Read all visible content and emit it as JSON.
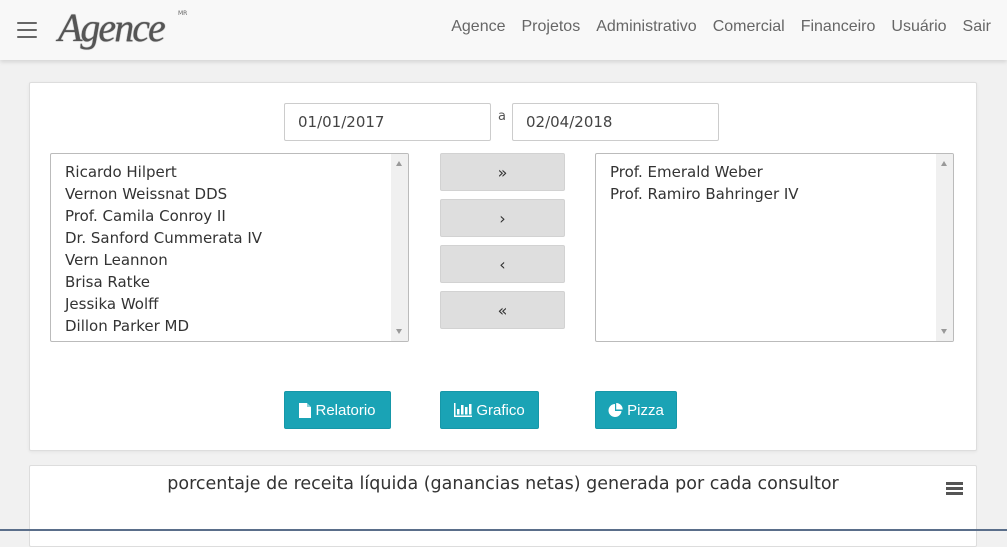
{
  "navbar": {
    "logo": "Agence",
    "logo_mark": "MR",
    "links": [
      "Agence",
      "Projetos",
      "Administrativo",
      "Comercial",
      "Financeiro",
      "Usuário",
      "Sair"
    ]
  },
  "filters": {
    "date_from": "01/01/2017",
    "separator": "a",
    "date_to": "02/04/2018"
  },
  "available_consultants": [
    "Ricardo Hilpert",
    "Vernon Weissnat DDS",
    "Prof. Camila Conroy II",
    "Dr. Sanford Cummerata IV",
    "Vern Leannon",
    "Brisa Ratke",
    "Jessika Wolff",
    "Dillon Parker MD"
  ],
  "selected_consultants": [
    "Prof. Emerald Weber",
    "Prof. Ramiro Bahringer IV"
  ],
  "move_buttons": {
    "add_all": "»",
    "add_one": "›",
    "remove_one": "‹",
    "remove_all": "«"
  },
  "actions": {
    "relatorio": "Relatorio",
    "grafico": "Grafico",
    "pizza": "Pizza"
  },
  "chart": {
    "title": "porcentaje de receita líquida (ganancias netas) generada por cada consultor"
  },
  "colors": {
    "primary": "#1aa3b5",
    "button_gray": "#dedede"
  }
}
